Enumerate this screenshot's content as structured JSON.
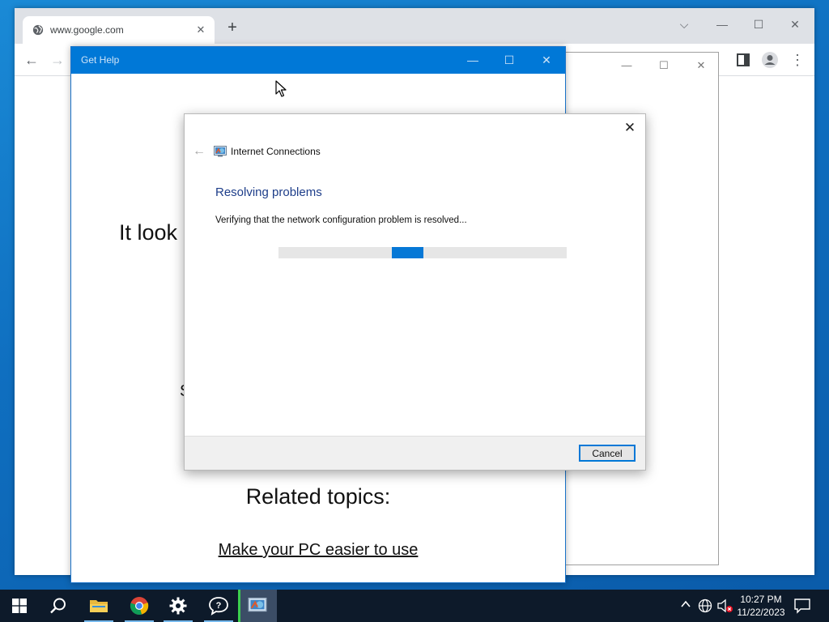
{
  "browser": {
    "tab_title": "www.google.com",
    "tab_close": "✕",
    "new_tab": "+",
    "win_controls": {
      "chevron": "⌵",
      "minimize": "—",
      "maximize": "☐",
      "close": "✕"
    },
    "nav": {
      "back": "←",
      "forward": "→",
      "menu": "⋮"
    }
  },
  "background_window": {
    "controls": {
      "minimize": "—",
      "maximize": "☐",
      "close": "✕"
    }
  },
  "get_help": {
    "title": "Get Help",
    "controls": {
      "minimize": "—",
      "maximize": "☐",
      "close": "✕"
    },
    "heading_partial": "It look",
    "partial_text": "S",
    "related_topics": "Related topics:",
    "link": "Make your PC easier to use"
  },
  "dialog": {
    "close": "✕",
    "back": "←",
    "app_title": "Internet Connections",
    "heading": "Resolving problems",
    "status": "Verifying that the network configuration problem is resolved...",
    "progress": {
      "indeterminate": true,
      "chunk_start": 0.394,
      "chunk_width": 0.11
    },
    "cancel_label": "Cancel"
  },
  "taskbar": {
    "items": [
      {
        "name": "start-button",
        "icon": "windows-logo"
      },
      {
        "name": "search-button",
        "icon": "search-icon"
      },
      {
        "name": "file-explorer",
        "icon": "folder-icon",
        "running": true
      },
      {
        "name": "chrome",
        "icon": "chrome-icon",
        "running": true
      },
      {
        "name": "settings",
        "icon": "gear-icon",
        "running": true
      },
      {
        "name": "get-help",
        "icon": "help-icon",
        "running": true
      },
      {
        "name": "troubleshooter",
        "icon": "network-troubleshooter-icon",
        "active": true
      }
    ],
    "clock": {
      "time": "10:27 PM",
      "date": "11/22/2023"
    }
  },
  "colors": {
    "accent": "#0078d7",
    "dialog_heading": "#1e3e8a",
    "progress": "#0678d6",
    "taskbar": "#0d1a2a"
  }
}
